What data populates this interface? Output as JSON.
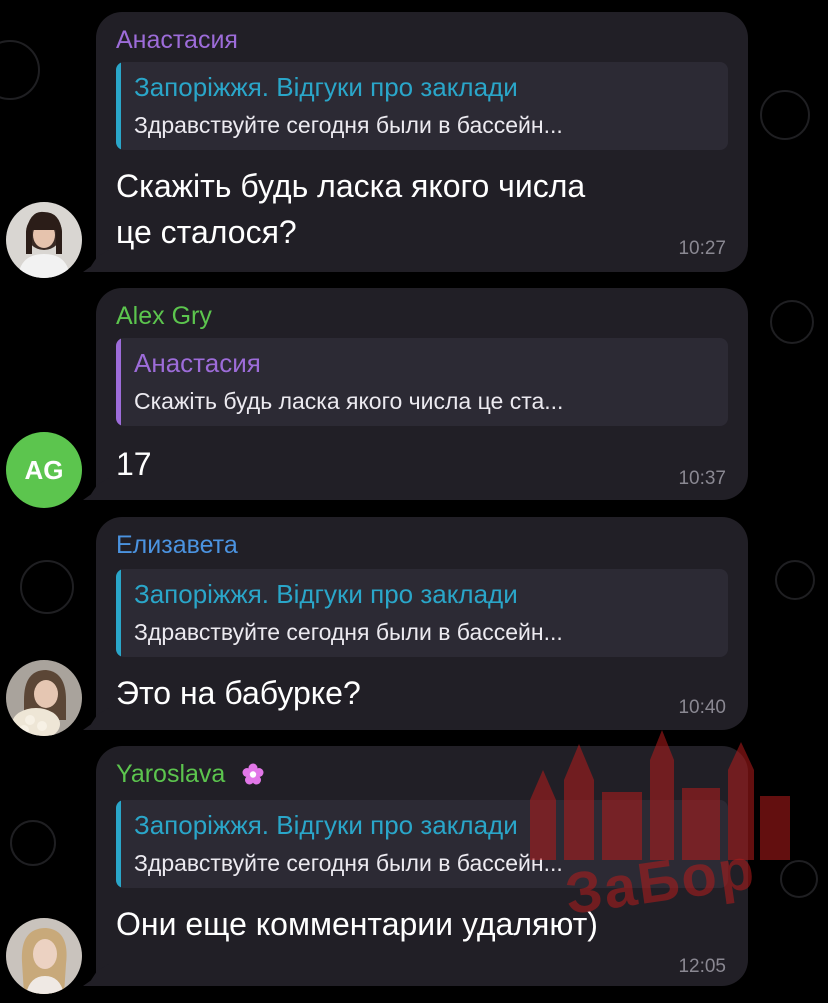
{
  "colors": {
    "bubble": "#211f26",
    "reply_bg": "#2c2a34",
    "timestamp": "#8a8892",
    "purple": "#9d6cd9",
    "green": "#5cc54e",
    "blue": "#4b93e0",
    "teal": "#2aa6c9",
    "avatar_ag": "#5cc54e",
    "watermark": "#b41c1c"
  },
  "messages": [
    {
      "sender": "Анастасия",
      "reply_title": "Запоріжжя. Відгуки про заклади",
      "reply_text": "Здравствуйте сегодня были в бассейн...",
      "text_line1": "Скажіть будь ласка якого числа",
      "text_line2": "це сталося?",
      "time": "10:27",
      "avatar": "photo"
    },
    {
      "sender": "Alex Gry",
      "reply_title": "Анастасия",
      "reply_text": "Скажіть будь ласка якого числа це ста...",
      "text_line1": "17",
      "time": "10:37",
      "avatar_initials": "AG"
    },
    {
      "sender": "Елизавета",
      "reply_title": "Запоріжжя. Відгуки про заклади",
      "reply_text": "Здравствуйте сегодня были в бассейн...",
      "text_line1": "Это на бабурке?",
      "time": "10:40",
      "avatar": "photo"
    },
    {
      "sender": "Yaroslava",
      "sender_badge_icon": "flower-icon",
      "reply_title": "Запоріжжя. Відгуки про заклади",
      "reply_text": "Здравствуйте сегодня были в бассейн...",
      "text_line1": "Они еще комментарии удаляют)",
      "time": "12:05",
      "avatar": "photo"
    }
  ],
  "watermark": {
    "text": "ЗаБор",
    "icon": "city-skyline-logo-icon"
  }
}
